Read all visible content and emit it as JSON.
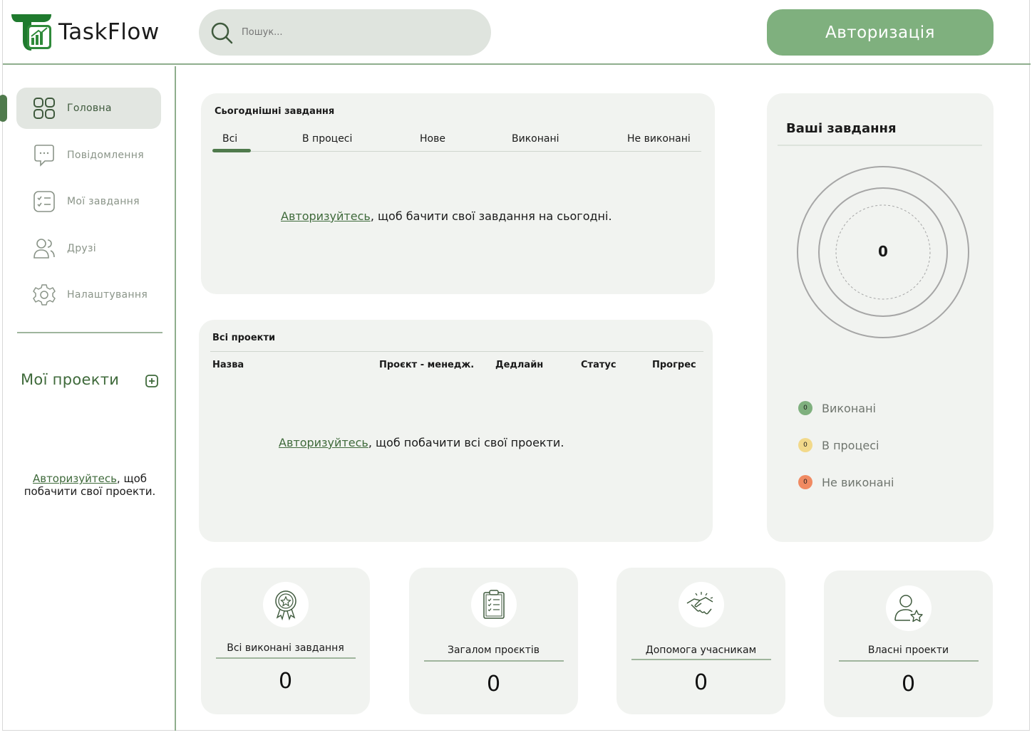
{
  "app": {
    "name": "TaskFlow"
  },
  "header": {
    "search_placeholder": "Пошук...",
    "auth_button": "Авторизація"
  },
  "sidebar": {
    "items": [
      {
        "label": "Головна",
        "icon": "grid-icon",
        "active": true
      },
      {
        "label": "Повідомлення",
        "icon": "chat-bubble-icon",
        "active": false
      },
      {
        "label": "Мої завдання",
        "icon": "checklist-icon",
        "active": false
      },
      {
        "label": "Друзі",
        "icon": "friends-icon",
        "active": false
      },
      {
        "label": "Налаштування",
        "icon": "gear-icon",
        "active": false
      }
    ],
    "projects_title": "Мої проекти",
    "auth_link": "Авторизуйтесь",
    "auth_rest": ", щоб побачити свої проекти."
  },
  "today": {
    "title": "Сьогоднішні завдання",
    "tabs": [
      "Всі",
      "В процесі",
      "Нове",
      "Виконані",
      "Не виконані"
    ],
    "auth_link": "Авторизуйтесь",
    "auth_rest": ", щоб бачити свої завдання на сьогодні."
  },
  "projects": {
    "title": "Всі проекти",
    "columns": [
      "Назва",
      "Проєкт - менедж.",
      "Дедлайн",
      "Статус",
      "Прогрес"
    ],
    "auth_link": "Авторизуйтесь",
    "auth_rest": ", щоб побачити всі свої проекти."
  },
  "your_tasks": {
    "title": "Ваші завдання",
    "total": "0",
    "legend": [
      {
        "label": "Виконані",
        "count": "0",
        "color": "#7fb07e"
      },
      {
        "label": "В процесі",
        "count": "0",
        "color": "#f2d98a"
      },
      {
        "label": "Не виконані",
        "count": "0",
        "color": "#f08a62"
      }
    ]
  },
  "stats": [
    {
      "label": "Всі виконані завдання",
      "value": "0",
      "icon": "award-ribbon-icon"
    },
    {
      "label": "Загалом проєктів",
      "value": "0",
      "icon": "clipboard-list-icon"
    },
    {
      "label": "Допомога учасникам",
      "value": "0",
      "icon": "handshake-icon"
    },
    {
      "label": "Власні проекти",
      "value": "0",
      "icon": "user-star-icon"
    }
  ],
  "colors": {
    "accent": "#7fb07e",
    "accent_dark": "#4f7a4c",
    "card_bg": "#f1f3f0",
    "search_bg": "#dfe4de"
  }
}
